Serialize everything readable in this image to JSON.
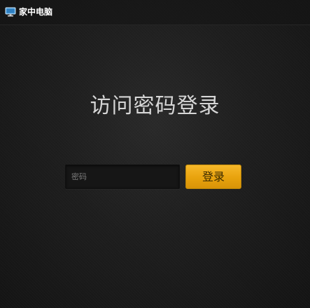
{
  "header": {
    "icon": "monitor-icon",
    "title": "家中电脑"
  },
  "main": {
    "title": "访问密码登录",
    "password_placeholder": "密码",
    "password_value": "",
    "login_label": "登录"
  },
  "colors": {
    "background": "#1a1a1a",
    "accent": "#e8a20d",
    "title_text": "#d6d6d6"
  }
}
